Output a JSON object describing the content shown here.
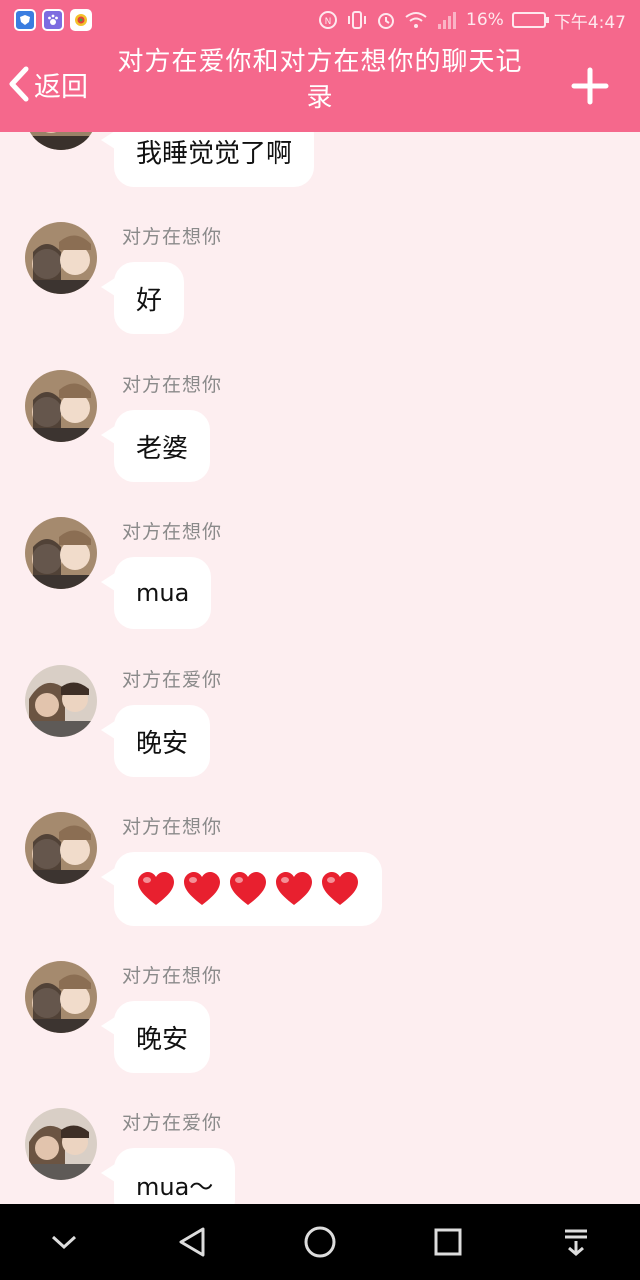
{
  "status_bar": {
    "battery": "16%",
    "time": "下午4:47"
  },
  "header": {
    "back_label": "返回",
    "title": "对方在爱你和对方在想你的聊天记录"
  },
  "messages": [
    {
      "sender": "",
      "text": "我睡觉觉了啊"
    },
    {
      "sender": "对方在想你",
      "text": "好"
    },
    {
      "sender": "对方在想你",
      "text": "老婆"
    },
    {
      "sender": "对方在想你",
      "text": "mua"
    },
    {
      "sender": "对方在爱你",
      "text": "晚安"
    },
    {
      "sender": "对方在想你",
      "hearts": 5
    },
    {
      "sender": "对方在想你",
      "text": "晚安"
    },
    {
      "sender": "对方在爱你",
      "text": "mua～"
    }
  ],
  "colors": {
    "header": "#f5688c",
    "background": "#fdeef0",
    "bubble": "#ffffff",
    "heart": "#e8202f"
  }
}
